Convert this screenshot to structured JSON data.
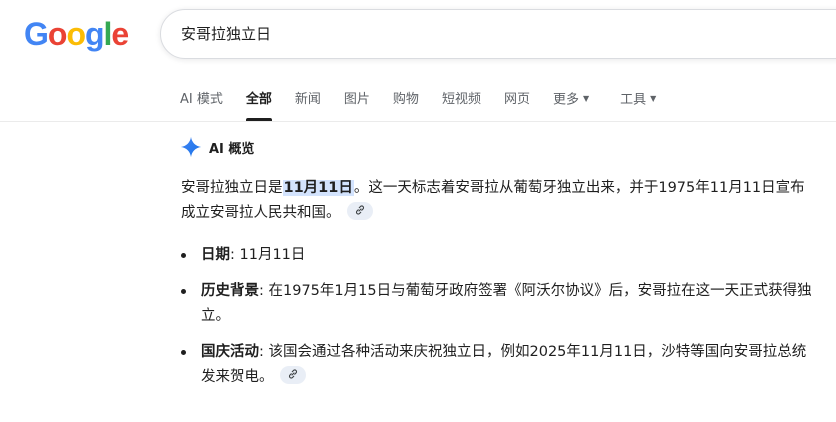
{
  "logo": {
    "letters": [
      "G",
      "o",
      "o",
      "g",
      "l",
      "e"
    ],
    "colors": [
      "#4285F4",
      "#EA4335",
      "#FBBC05",
      "#4285F4",
      "#34A853",
      "#EA4335"
    ]
  },
  "search": {
    "query": "安哥拉独立日"
  },
  "tabs": [
    {
      "label": "AI 模式",
      "active": false
    },
    {
      "label": "全部",
      "active": true
    },
    {
      "label": "新闻",
      "active": false
    },
    {
      "label": "图片",
      "active": false
    },
    {
      "label": "购物",
      "active": false
    },
    {
      "label": "短视频",
      "active": false
    },
    {
      "label": "网页",
      "active": false
    },
    {
      "label": "更多",
      "active": false
    }
  ],
  "tools_label": "工具",
  "ai_overview": {
    "title": "AI 概览",
    "summary": {
      "before": "安哥拉独立日是",
      "highlight": "11月11日",
      "after": "。这一天标志着安哥拉从葡萄牙独立出来，并于1975年11月11日宣布成立安哥拉人民共和国。"
    },
    "bullets": [
      {
        "label": "日期",
        "text": ": 11月11日"
      },
      {
        "label": "历史背景",
        "text": ": 在1975年1月15日与葡萄牙政府签署《阿沃尔协议》后，安哥拉在这一天正式获得独立。"
      },
      {
        "label": "国庆活动",
        "text": ": 该国会通过各种活动来庆祝独立日，例如2025年11月11日，沙特等国向安哥拉总统发来贺电。"
      }
    ]
  },
  "icons": {
    "sparkle": "gemini-sparkle-icon",
    "link": "link-icon",
    "caret": "caret-down-icon"
  },
  "colors": {
    "accent": "#1a73e8",
    "chip_bg": "#e9eef6",
    "highlight_bg": "#d3e3fd"
  }
}
